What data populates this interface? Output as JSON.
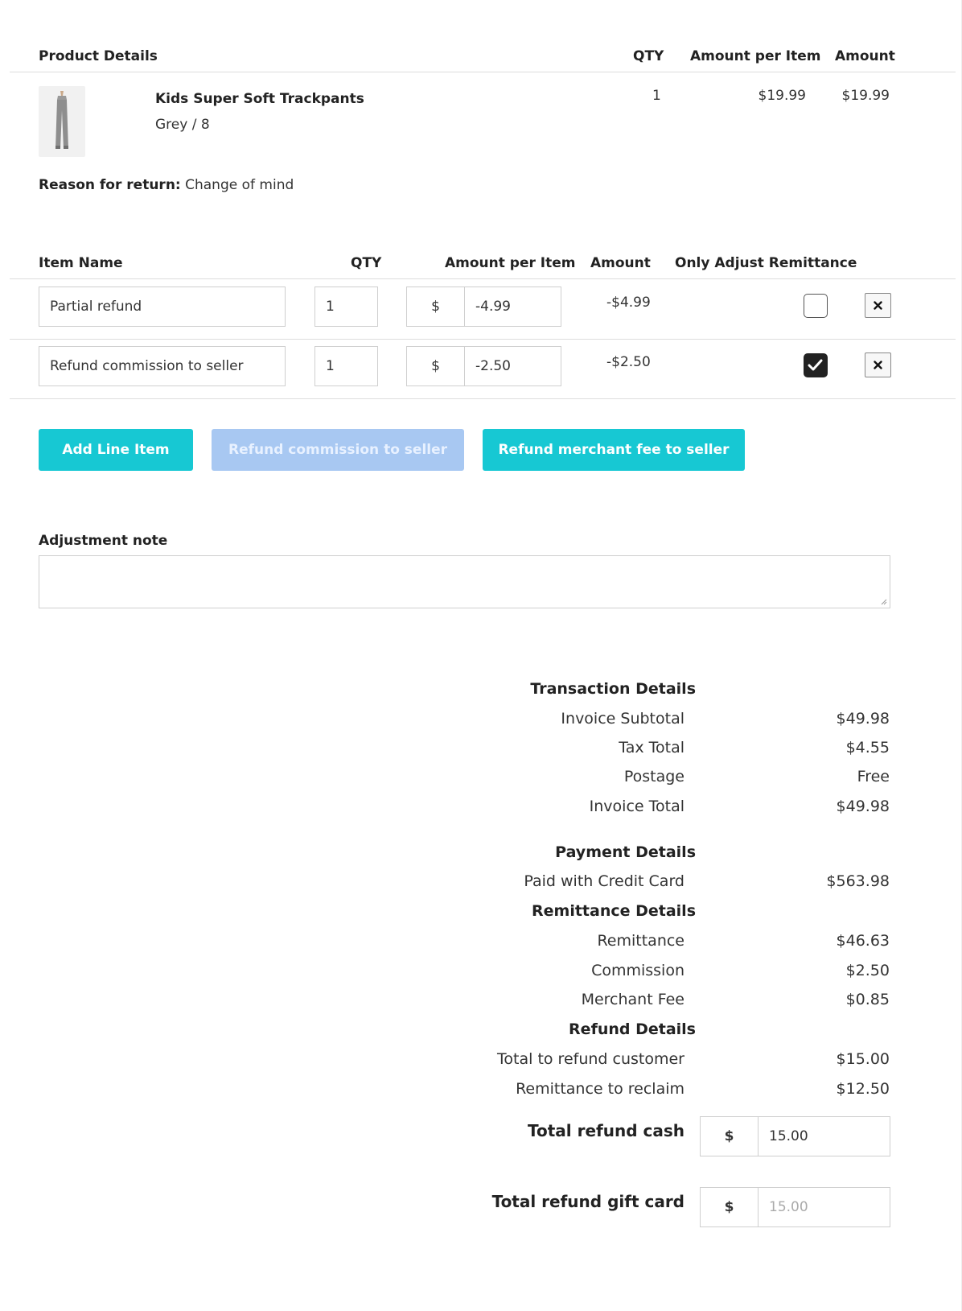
{
  "product_table": {
    "headers": {
      "details": "Product Details",
      "qty": "QTY",
      "amount_per_item": "Amount per Item",
      "amount": "Amount"
    },
    "product": {
      "image_icon": "trackpants-thumbnail",
      "name": "Kids Super Soft Trackpants",
      "variant": "Grey / 8",
      "qty": "1",
      "amount_per_item": "$19.99",
      "amount": "$19.99"
    },
    "reason_label": "Reason for return:",
    "reason_value": "Change of mind"
  },
  "line_items": {
    "headers": {
      "item_name": "Item Name",
      "qty": "QTY",
      "amount_per_item": "Amount per Item",
      "amount": "Amount",
      "only_adjust": "Only Adjust Remittance"
    },
    "currency_symbol": "$",
    "rows": [
      {
        "name": "Partial refund",
        "qty": "1",
        "price": "-4.99",
        "amount": "-$4.99",
        "only_adjust": false
      },
      {
        "name": "Refund commission to seller",
        "qty": "1",
        "price": "-2.50",
        "amount": "-$2.50",
        "only_adjust": true
      }
    ]
  },
  "buttons": {
    "add_line_item": "Add Line Item",
    "refund_commission": "Refund commission to seller",
    "refund_merchant_fee": "Refund merchant fee to seller"
  },
  "adjustment_note": {
    "label": "Adjustment note",
    "value": ""
  },
  "summary": {
    "transaction_heading": "Transaction Details",
    "invoice_subtotal_label": "Invoice Subtotal",
    "invoice_subtotal": "$49.98",
    "tax_total_label": "Tax Total",
    "tax_total": "$4.55",
    "postage_label": "Postage",
    "postage": "Free",
    "invoice_total_label": "Invoice Total",
    "invoice_total": "$49.98",
    "payment_heading": "Payment Details",
    "paid_credit_label": "Paid with Credit Card",
    "paid_credit": "$563.98",
    "remittance_heading": "Remittance Details",
    "remittance_label": "Remittance",
    "remittance": "$46.63",
    "commission_label": "Commission",
    "commission": "$2.50",
    "merchant_fee_label": "Merchant Fee",
    "merchant_fee": "$0.85",
    "refund_heading": "Refund Details",
    "total_refund_customer_label": "Total to refund customer",
    "total_refund_customer": "$15.00",
    "remittance_reclaim_label": "Remittance to reclaim",
    "remittance_reclaim": "$12.50",
    "total_refund_cash_label": "Total refund cash",
    "total_refund_cash": "15.00",
    "total_refund_gift_label": "Total refund gift card",
    "total_refund_gift_placeholder": "15.00",
    "currency_symbol": "$"
  },
  "colors": {
    "accent": "#17c8d3",
    "disabled_button": "#a8c8f2"
  }
}
